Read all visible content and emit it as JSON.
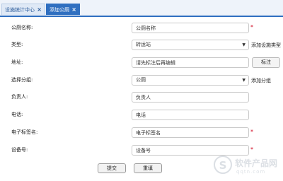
{
  "tabs": [
    {
      "label": "设施统计中心",
      "close": "×",
      "active": false
    },
    {
      "label": "添加公厕",
      "close": "×",
      "active": true
    }
  ],
  "form": {
    "name": {
      "label": "公厕名称:",
      "placeholder": "公厕名称",
      "required": "*"
    },
    "type": {
      "label": "类型:",
      "value": "转运站",
      "side_link": "添加设施类型"
    },
    "address": {
      "label": "地址:",
      "placeholder": "请先标注后再编辑",
      "button": "标注"
    },
    "group": {
      "label": "选择分组:",
      "value": "公厕",
      "side_link": "添加分组"
    },
    "owner": {
      "label": "负责人:",
      "placeholder": "负责人"
    },
    "phone": {
      "label": "电话:",
      "placeholder": "电话"
    },
    "etag": {
      "label": "电子标签名:",
      "placeholder": "电子标签名",
      "required": "*"
    },
    "device": {
      "label": "设备号:",
      "placeholder": "设备号",
      "required": "*"
    }
  },
  "actions": {
    "submit": "提交",
    "reset": "重填"
  },
  "watermark": {
    "letter": "S",
    "text": "软件产品网",
    "url": "qqtn.com"
  },
  "colors": {
    "accent": "#2f6fc0",
    "required": "#d0021b"
  }
}
